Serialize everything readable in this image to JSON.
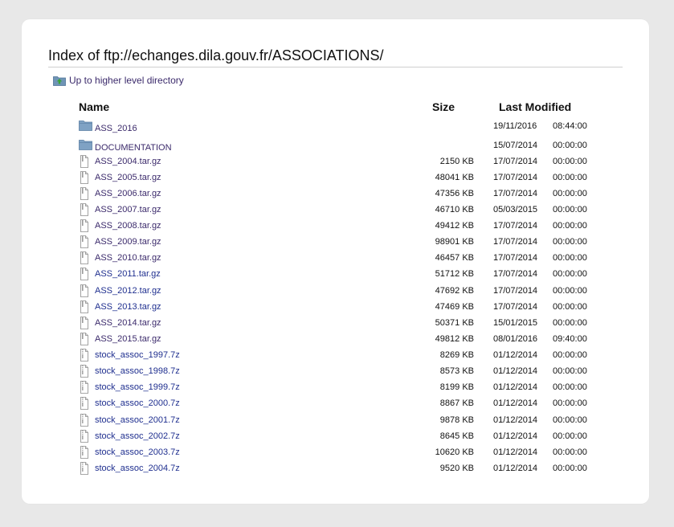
{
  "page": {
    "title": "Index of ftp://echanges.dila.gouv.fr/ASSOCIATIONS/",
    "up_link": "Up to higher level directory"
  },
  "columns": {
    "name": "Name",
    "size": "Size",
    "modified": "Last Modified"
  },
  "colors": {
    "link": "#3b2a6b",
    "link_blue": "#1f2f8f",
    "folder": "#6f94b6",
    "up_icon_green": "#3aa635"
  },
  "files": [
    {
      "name": "ASS_2016",
      "size": "",
      "date": "19/11/2016",
      "time": "08:44:00",
      "type": "folder",
      "icon": "folder-icon"
    },
    {
      "name": "DOCUMENTATION",
      "size": "",
      "date": "15/07/2014",
      "time": "00:00:00",
      "type": "folder",
      "icon": "folder-icon"
    },
    {
      "name": "ASS_2004.tar.gz",
      "size": "2150 KB",
      "date": "17/07/2014",
      "time": "00:00:00",
      "type": "file",
      "icon": "file-icon"
    },
    {
      "name": "ASS_2005.tar.gz",
      "size": "48041 KB",
      "date": "17/07/2014",
      "time": "00:00:00",
      "type": "file",
      "icon": "file-icon"
    },
    {
      "name": "ASS_2006.tar.gz",
      "size": "47356 KB",
      "date": "17/07/2014",
      "time": "00:00:00",
      "type": "file",
      "icon": "file-icon"
    },
    {
      "name": "ASS_2007.tar.gz",
      "size": "46710 KB",
      "date": "05/03/2015",
      "time": "00:00:00",
      "type": "file",
      "icon": "file-icon"
    },
    {
      "name": "ASS_2008.tar.gz",
      "size": "49412 KB",
      "date": "17/07/2014",
      "time": "00:00:00",
      "type": "file",
      "icon": "file-icon"
    },
    {
      "name": "ASS_2009.tar.gz",
      "size": "98901 KB",
      "date": "17/07/2014",
      "time": "00:00:00",
      "type": "file",
      "icon": "file-icon"
    },
    {
      "name": "ASS_2010.tar.gz",
      "size": "46457 KB",
      "date": "17/07/2014",
      "time": "00:00:00",
      "type": "file",
      "icon": "file-icon"
    },
    {
      "name": "ASS_2011.tar.gz",
      "size": "51712 KB",
      "date": "17/07/2014",
      "time": "00:00:00",
      "type": "file",
      "icon": "file-icon"
    },
    {
      "name": "ASS_2012.tar.gz",
      "size": "47692 KB",
      "date": "17/07/2014",
      "time": "00:00:00",
      "type": "file",
      "icon": "file-icon"
    },
    {
      "name": "ASS_2013.tar.gz",
      "size": "47469 KB",
      "date": "17/07/2014",
      "time": "00:00:00",
      "type": "file",
      "icon": "file-icon"
    },
    {
      "name": "ASS_2014.tar.gz",
      "size": "50371 KB",
      "date": "15/01/2015",
      "time": "00:00:00",
      "type": "file",
      "icon": "file-icon"
    },
    {
      "name": "ASS_2015.tar.gz",
      "size": "49812 KB",
      "date": "08/01/2016",
      "time": "09:40:00",
      "type": "file",
      "icon": "file-icon"
    },
    {
      "name": "stock_assoc_1997.7z",
      "size": "8269 KB",
      "date": "01/12/2014",
      "time": "00:00:00",
      "type": "archive",
      "icon": "archive-file-icon"
    },
    {
      "name": "stock_assoc_1998.7z",
      "size": "8573 KB",
      "date": "01/12/2014",
      "time": "00:00:00",
      "type": "archive",
      "icon": "archive-file-icon"
    },
    {
      "name": "stock_assoc_1999.7z",
      "size": "8199 KB",
      "date": "01/12/2014",
      "time": "00:00:00",
      "type": "archive",
      "icon": "archive-file-icon"
    },
    {
      "name": "stock_assoc_2000.7z",
      "size": "8867 KB",
      "date": "01/12/2014",
      "time": "00:00:00",
      "type": "archive",
      "icon": "archive-file-icon"
    },
    {
      "name": "stock_assoc_2001.7z",
      "size": "9878 KB",
      "date": "01/12/2014",
      "time": "00:00:00",
      "type": "archive",
      "icon": "archive-file-icon"
    },
    {
      "name": "stock_assoc_2002.7z",
      "size": "8645 KB",
      "date": "01/12/2014",
      "time": "00:00:00",
      "type": "archive",
      "icon": "archive-file-icon"
    },
    {
      "name": "stock_assoc_2003.7z",
      "size": "10620 KB",
      "date": "01/12/2014",
      "time": "00:00:00",
      "type": "archive",
      "icon": "archive-file-icon"
    },
    {
      "name": "stock_assoc_2004.7z",
      "size": "9520 KB",
      "date": "01/12/2014",
      "time": "00:00:00",
      "type": "archive",
      "icon": "archive-file-icon"
    }
  ]
}
